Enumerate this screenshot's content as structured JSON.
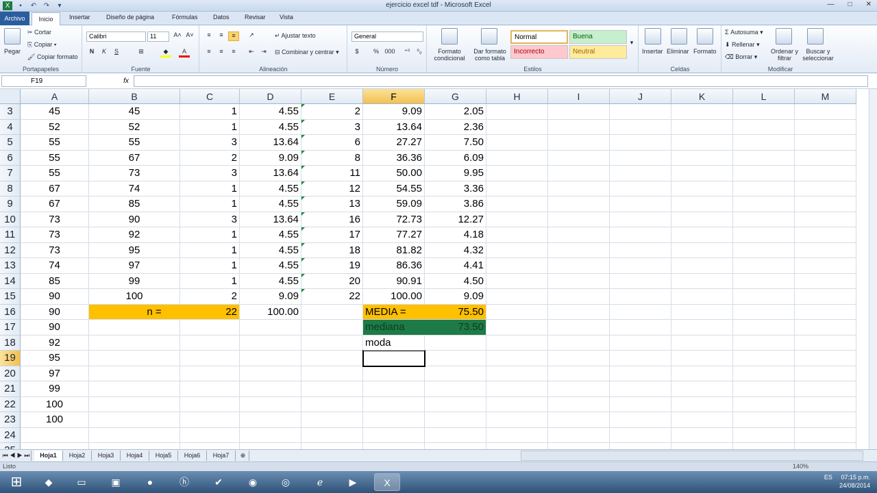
{
  "window": {
    "title": "ejercicio excel tdf - Microsoft Excel"
  },
  "ribbon_tabs": [
    "Archivo",
    "Inicio",
    "Insertar",
    "Diseño de página",
    "Fórmulas",
    "Datos",
    "Revisar",
    "Vista"
  ],
  "ribbon": {
    "portapapeles": {
      "label": "Portapapeles",
      "pegar": "Pegar",
      "cortar": "Cortar",
      "copiar": "Copiar",
      "copiar_formato": "Copiar formato"
    },
    "fuente": {
      "label": "Fuente",
      "font": "Calibri",
      "size": "11"
    },
    "alineacion": {
      "label": "Alineación",
      "ajustar": "Ajustar texto",
      "combinar": "Combinar y centrar"
    },
    "numero": {
      "label": "Número",
      "format": "General"
    },
    "estilos": {
      "label": "Estilos",
      "formato_cond": "Formato condicional",
      "dar_formato": "Dar formato como tabla",
      "normal": "Normal",
      "buena": "Buena",
      "incorrecto": "Incorrecto",
      "neutral": "Neutral"
    },
    "celdas": {
      "label": "Celdas",
      "insertar": "Insertar",
      "eliminar": "Eliminar",
      "formato": "Formato"
    },
    "modificar": {
      "label": "Modificar",
      "autosuma": "Autosuma",
      "rellenar": "Rellenar",
      "borrar": "Borrar",
      "ordenar": "Ordenar y filtrar",
      "buscar": "Buscar y seleccionar"
    }
  },
  "formula_bar": {
    "name_box": "F19",
    "fx": "fx",
    "formula": ""
  },
  "columns": [
    "A",
    "B",
    "C",
    "D",
    "E",
    "F",
    "G",
    "H",
    "I",
    "J",
    "K",
    "L",
    "M"
  ],
  "selected_column": "F",
  "selected_row": "19",
  "rows": [
    {
      "n": "3",
      "A": "45",
      "B": "45",
      "C": "1",
      "D": "4.55",
      "E": "2",
      "F": "9.09",
      "G": "2.05"
    },
    {
      "n": "4",
      "A": "52",
      "B": "52",
      "C": "1",
      "D": "4.55",
      "E": "3",
      "F": "13.64",
      "G": "2.36"
    },
    {
      "n": "5",
      "A": "55",
      "B": "55",
      "C": "3",
      "D": "13.64",
      "E": "6",
      "F": "27.27",
      "G": "7.50"
    },
    {
      "n": "6",
      "A": "55",
      "B": "67",
      "C": "2",
      "D": "9.09",
      "E": "8",
      "F": "36.36",
      "G": "6.09"
    },
    {
      "n": "7",
      "A": "55",
      "B": "73",
      "C": "3",
      "D": "13.64",
      "E": "11",
      "F": "50.00",
      "G": "9.95"
    },
    {
      "n": "8",
      "A": "67",
      "B": "74",
      "C": "1",
      "D": "4.55",
      "E": "12",
      "F": "54.55",
      "G": "3.36"
    },
    {
      "n": "9",
      "A": "67",
      "B": "85",
      "C": "1",
      "D": "4.55",
      "E": "13",
      "F": "59.09",
      "G": "3.86"
    },
    {
      "n": "10",
      "A": "73",
      "B": "90",
      "C": "3",
      "D": "13.64",
      "E": "16",
      "F": "72.73",
      "G": "12.27"
    },
    {
      "n": "11",
      "A": "73",
      "B": "92",
      "C": "1",
      "D": "4.55",
      "E": "17",
      "F": "77.27",
      "G": "4.18"
    },
    {
      "n": "12",
      "A": "73",
      "B": "95",
      "C": "1",
      "D": "4.55",
      "E": "18",
      "F": "81.82",
      "G": "4.32"
    },
    {
      "n": "13",
      "A": "74",
      "B": "97",
      "C": "1",
      "D": "4.55",
      "E": "19",
      "F": "86.36",
      "G": "4.41"
    },
    {
      "n": "14",
      "A": "85",
      "B": "99",
      "C": "1",
      "D": "4.55",
      "E": "20",
      "F": "90.91",
      "G": "4.50"
    },
    {
      "n": "15",
      "A": "90",
      "B": "100",
      "C": "2",
      "D": "9.09",
      "E": "22",
      "F": "100.00",
      "G": "9.09"
    },
    {
      "n": "16",
      "A": "90",
      "B": "n  =",
      "C": "22",
      "D": "100.00",
      "E": "",
      "F": "MEDIA  =",
      "G": "75.50"
    },
    {
      "n": "17",
      "A": "90",
      "B": "",
      "C": "",
      "D": "",
      "E": "",
      "F": "mediana",
      "G": "73.50"
    },
    {
      "n": "18",
      "A": "92",
      "B": "",
      "C": "",
      "D": "",
      "E": "",
      "F": "moda",
      "G": ""
    },
    {
      "n": "19",
      "A": "95",
      "B": "",
      "C": "",
      "D": "",
      "E": "",
      "F": "",
      "G": ""
    },
    {
      "n": "20",
      "A": "97",
      "B": "",
      "C": "",
      "D": "",
      "E": "",
      "F": "",
      "G": ""
    },
    {
      "n": "21",
      "A": "99",
      "B": "",
      "C": "",
      "D": "",
      "E": "",
      "F": "",
      "G": ""
    },
    {
      "n": "22",
      "A": "100",
      "B": "",
      "C": "",
      "D": "",
      "E": "",
      "F": "",
      "G": ""
    },
    {
      "n": "23",
      "A": "100",
      "B": "",
      "C": "",
      "D": "",
      "E": "",
      "F": "",
      "G": ""
    },
    {
      "n": "24",
      "A": "",
      "B": "",
      "C": "",
      "D": "",
      "E": "",
      "F": "",
      "G": ""
    },
    {
      "n": "25",
      "A": "",
      "B": "",
      "C": "",
      "D": "",
      "E": "",
      "F": "",
      "G": ""
    }
  ],
  "highlights": {
    "orange": "#ffc000",
    "green": "#1e7a46"
  },
  "sheet_tabs": [
    "Hoja1",
    "Hoja2",
    "Hoja3",
    "Hoja4",
    "Hoja5",
    "Hoja6",
    "Hoja7"
  ],
  "active_sheet": "Hoja1",
  "status": {
    "text": "Listo",
    "zoom": "140%"
  },
  "tray": {
    "lang": "ES",
    "time": "07:15 p.m.",
    "date": "24/08/2014"
  }
}
